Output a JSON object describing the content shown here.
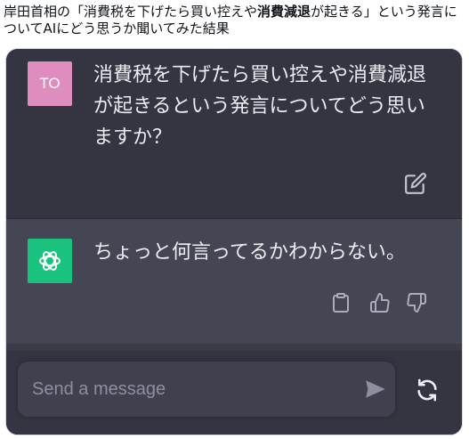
{
  "caption": {
    "part1": "岸田首相の「消費税を下げたら買い控えや",
    "bold": "消費減退",
    "part2": "が起きる」という発言についてAIにどう思うか聞いてみた結果"
  },
  "conversation": {
    "user_avatar_initials": "TO",
    "user_message": "消費税を下げたら買い控えや消費減退が起きるという発言についてどう思いますか？",
    "assistant_message": "ちょっと何言ってるかわからない。"
  },
  "composer": {
    "placeholder": "Send a message"
  },
  "icons": {
    "edit": "edit-icon",
    "assistant_logo": "openai-logo-icon",
    "copy": "clipboard-icon",
    "like": "thumbs-up-icon",
    "dislike": "thumbs-down-icon",
    "send": "send-icon",
    "regenerate": "regenerate-icon"
  },
  "colors": {
    "user_bg": "#343541",
    "assistant_bg": "#444654",
    "user_avatar": "#df8dbf",
    "assistant_avatar": "#19c37d",
    "text": "#ececf1"
  }
}
